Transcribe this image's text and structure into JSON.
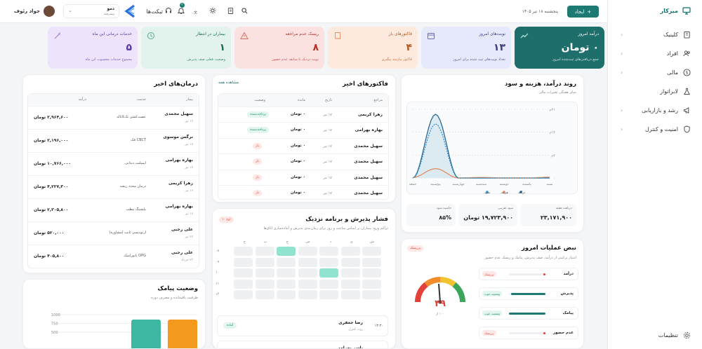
{
  "sidebar": {
    "items": [
      {
        "label": "میزکار",
        "icon": "monitor-icon",
        "active": true
      },
      {
        "label": "کلینیک",
        "icon": "building-icon"
      },
      {
        "label": "افراد",
        "icon": "users-icon"
      },
      {
        "label": "مالی",
        "icon": "dollar-icon"
      },
      {
        "label": "لابراتوار",
        "icon": "flask-icon"
      },
      {
        "label": "رشد و بازاریابی",
        "icon": "megaphone-icon"
      },
      {
        "label": "امنیت و کنترل",
        "icon": "shield-icon"
      }
    ],
    "settings": "تنظیمات"
  },
  "topbar": {
    "user_name": "جواد رئوف",
    "clinic_name": "دمو",
    "clinic_role": "پیشرفته",
    "tickets": "تیکت‌ها",
    "notif_count": "۳",
    "date": "پنجشنبه ۱۸ تیر ۱۴۰۵",
    "create_button": "ایجاد"
  },
  "kpis": [
    {
      "title": "درآمد امروز",
      "value": "۰ تومان",
      "sub": "جمع دریافتی‌های ثبت‌شده امروز",
      "icon": "trend-icon"
    },
    {
      "title": "نوبت‌های امروز",
      "value": "۱۳",
      "sub": "تعداد نوبت‌های ثبت شده برای امروز",
      "icon": "calendar-icon"
    },
    {
      "title": "فاکتورهای باز",
      "value": "۴",
      "sub": "فاکتور نیازمند پیگیری",
      "icon": "receipt-icon"
    },
    {
      "title": "ریسک عدم مراجعه",
      "value": "۸",
      "sub": "نوبت نزدیک با سابقه عدم حضور",
      "icon": "warning-icon"
    },
    {
      "title": "بیماران در انتظار",
      "value": "۱",
      "sub": "وضعیت فعلی صف پذیرش",
      "icon": "clock-icon"
    },
    {
      "title": "خدمات درمانی این ماه",
      "value": "۵",
      "sub": "مجموع خدمات محسوب این ماه",
      "icon": "wand-icon"
    }
  ],
  "revenue": {
    "title": "روند درآمد، هزینه و سود",
    "subtitle": "نمای هفتگی تغییرات مالی",
    "legend": [
      "درآمد",
      "هزینه",
      "سود"
    ],
    "footer": [
      {
        "label": "دریافت هفته",
        "value": "۲۳,۱۷۱,۹۰۰"
      },
      {
        "label": "سود تقریبی",
        "value": "۱۹,۷۲۳,۹۰۰ تومان"
      },
      {
        "label": "حاشیه سود",
        "value": "۸۵%"
      }
    ]
  },
  "chart_data": {
    "type": "line",
    "x": [
      "شنبه",
      "یکشنبه",
      "دوشنبه",
      "سه‌شنبه",
      "چهارشنبه",
      "پنج‌شنبه",
      "جمعه"
    ],
    "yticks": [
      "۰",
      "۲م",
      "۱۴م",
      "۲۱م"
    ],
    "series": [
      {
        "name": "درآمد",
        "values": [
          0,
          0,
          0,
          0,
          0,
          23.2,
          0
        ],
        "color": "#1f5f8b"
      },
      {
        "name": "هزینه",
        "values": [
          0.3,
          0,
          0,
          0.2,
          0,
          3.4,
          0.2
        ],
        "color": "#e0875a"
      },
      {
        "name": "سود",
        "values": [
          0,
          0,
          0,
          0,
          0,
          19.7,
          0
        ],
        "color": "#2b8cc4"
      }
    ]
  },
  "invoices": {
    "title": "فاکتورهای اخیر",
    "link": "مشاهده همه",
    "headers": [
      "مراجع",
      "تاریخ",
      "مانده",
      "وضعیت"
    ],
    "rows": [
      {
        "name": "زهرا کریمی",
        "date": "۱۷ تیر",
        "amount": "۰ تومان",
        "status": "پرداخت‌شده",
        "ok": true
      },
      {
        "name": "بهاره بهرامی",
        "date": "۱۷ تیر",
        "amount": "۰ تومان",
        "status": "پرداخت‌شده",
        "ok": true
      },
      {
        "name": "سهیل محمدی",
        "date": "۱۷ تیر",
        "amount": "۰ تومان",
        "status": "باز",
        "ok": false
      },
      {
        "name": "سهیل محمدی",
        "date": "۱۷ تیر",
        "amount": "۰ تومان",
        "status": "باز",
        "ok": false
      },
      {
        "name": "سهیل محمدی",
        "date": "۱۷ تیر",
        "amount": "۰ تومان",
        "status": "باز",
        "ok": false
      },
      {
        "name": "سهیل محمدی",
        "date": "۱۷ تیر",
        "amount": "۰ تومان",
        "status": "باز",
        "ok": false
      }
    ]
  },
  "treatments": {
    "title": "درمان‌های اخیر",
    "headers": [
      "بیمار",
      "خدمت",
      "درآمد"
    ],
    "rows": [
      {
        "name": "سهیل محمدی",
        "date": "۱۷ تیر",
        "service": "عصب‌کشی تک‌کاناله",
        "amount": "۲,۹۶۴,۶۰۰ تومان"
      },
      {
        "name": "نرگس موسوی",
        "date": "۱۷ تیر",
        "service": "CBCT فک",
        "amount": "۲,۱۹۶,۰۰۰ تومان"
      },
      {
        "name": "بهاره بهرامی",
        "date": "۱۷ تیر",
        "service": "ایمپلنت دندانی",
        "amount": "۱۰,۷۶۶,۰۰۰ تومان"
      },
      {
        "name": "زهرا کریمی",
        "date": "۱۷ تیر",
        "service": "درمان مجدد ریشه",
        "amount": "۴,۲۲۷,۳۰۰ تومان"
      },
      {
        "name": "بهاره بهرامی",
        "date": "۱۷ تیر",
        "service": "بلیچینگ مطب",
        "amount": "۲,۳۰۵,۸۰۰ تومان"
      },
      {
        "name": "علی رجبی",
        "date": "۲۷ تیر",
        "service": "ارتودنسی ثابت (مشاوره)",
        "amount": "۵۲۰,۰۰۰ تومان"
      },
      {
        "name": "علی رجبی",
        "date": "۲۳ خرداد",
        "service": "OPG پانورامیک",
        "amount": "۴۰۵,۸۰۰ تومان"
      }
    ]
  },
  "sms": {
    "title": "وضعیت پیامک",
    "subtitle": "ظرفیت باقیمانده و مصرف دوره",
    "chart": {
      "ticks": [
        "1000",
        "750",
        "500"
      ],
      "bars": [
        {
          "value": 860,
          "color": "#f39a1e"
        },
        {
          "value": 860,
          "color": "#3db7a0"
        }
      ]
    }
  },
  "schedule": {
    "title": "فشار پذیرش و برنامه نزدیک",
    "subtitle": "تراکم ورود بیماران بر اساس ساعت و روز برای زمان‌بندی پذیرش و آماده‌سازی اتاق‌ها",
    "badge": "اوج ۱۰",
    "days": [
      "ش",
      "ی",
      "د",
      "س",
      "چ",
      "پ",
      "ج"
    ],
    "hours": [
      "۰۸",
      "۰۹",
      "۱۰",
      "۱۱",
      "۱۲"
    ],
    "appointments": [
      {
        "name": "رضا جعفری",
        "service": "روت کنترل",
        "time": "۱۳:۳۰",
        "status": "آماده"
      },
      {
        "name": "یاسر بهرامی",
        "service": "",
        "time": "",
        "status": ""
      }
    ]
  },
  "pulse": {
    "title": "نبض عملیات امروز",
    "subtitle": "امتیاز ترکیبی از درآمد، صف پذیرش، پیامک و ریسک عدم حضور",
    "badge": "پرریسک",
    "score": "۴۹",
    "max": "۱۰۰ از",
    "metrics": [
      {
        "label": "درآمد",
        "status": "پرریسک",
        "fill": 0.05,
        "ok": false
      },
      {
        "label": "پذیرش",
        "status": "وضعیت خوب",
        "fill": 0.95,
        "ok": true
      },
      {
        "label": "پیامک",
        "status": "وضعیت خوب",
        "fill": 1.0,
        "ok": true
      },
      {
        "label": "عدم حضور",
        "status": "پرریسک",
        "fill": 0.05,
        "ok": false
      }
    ]
  }
}
